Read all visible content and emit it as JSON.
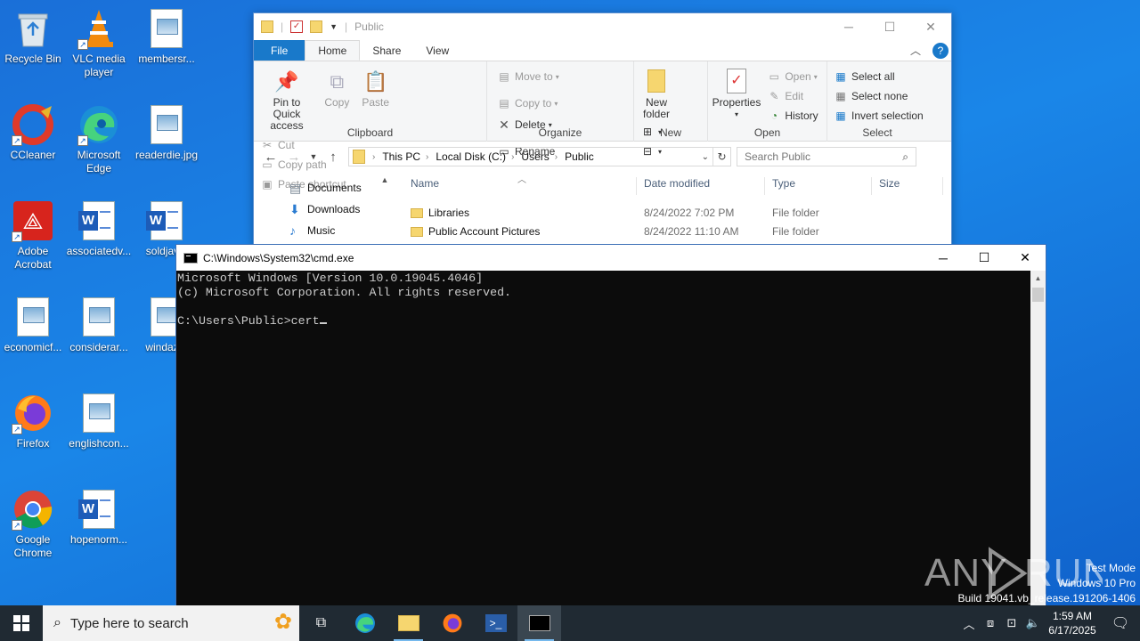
{
  "desktop": {
    "icons": [
      {
        "label": "Recycle Bin"
      },
      {
        "label": "VLC media player"
      },
      {
        "label": "membersr..."
      },
      {
        "label": "CCleaner"
      },
      {
        "label": "Microsoft Edge"
      },
      {
        "label": "readerdie.jpg"
      },
      {
        "label": "Adobe Acrobat"
      },
      {
        "label": "associatedv..."
      },
      {
        "label": "soldjav..."
      },
      {
        "label": "economicf..."
      },
      {
        "label": "considerar..."
      },
      {
        "label": "windaz..."
      },
      {
        "label": "Firefox"
      },
      {
        "label": "englishcon..."
      },
      {
        "label": "Google Chrome"
      },
      {
        "label": "hopenorm..."
      }
    ]
  },
  "explorer": {
    "title": "Public",
    "tabs": {
      "file": "File",
      "home": "Home",
      "share": "Share",
      "view": "View"
    },
    "clipboard": {
      "pin": "Pin to Quick access",
      "copy": "Copy",
      "paste": "Paste",
      "cut": "Cut",
      "copy_path": "Copy path",
      "paste_shortcut": "Paste shortcut",
      "label": "Clipboard"
    },
    "organize": {
      "move_to": "Move to",
      "copy_to": "Copy to",
      "delete": "Delete",
      "rename": "Rename",
      "label": "Organize"
    },
    "new": {
      "new_folder": "New folder",
      "label": "New"
    },
    "open": {
      "properties": "Properties",
      "open": "Open",
      "edit": "Edit",
      "history": "History",
      "label": "Open"
    },
    "select": {
      "select_all": "Select all",
      "select_none": "Select none",
      "invert": "Invert selection",
      "label": "Select"
    },
    "breadcrumb": [
      "This PC",
      "Local Disk (C:)",
      "Users",
      "Public"
    ],
    "search_placeholder": "Search Public",
    "nav_pane": [
      "Documents",
      "Downloads",
      "Music"
    ],
    "columns": {
      "name": "Name",
      "date": "Date modified",
      "type": "Type",
      "size": "Size"
    },
    "rows": [
      {
        "name": "Libraries",
        "date": "8/24/2022 7:02 PM",
        "type": "File folder"
      },
      {
        "name": "Public Account Pictures",
        "date": "8/24/2022 11:10 AM",
        "type": "File folder"
      }
    ]
  },
  "cmd": {
    "title": "C:\\Windows\\System32\\cmd.exe",
    "line1": "Microsoft Windows [Version 10.0.19045.4046]",
    "line2": "(c) Microsoft Corporation. All rights reserved.",
    "prompt": "C:\\Users\\Public>",
    "input": "cert"
  },
  "watermark": {
    "text": "ANY RUN"
  },
  "system_info": {
    "mode": "Test Mode",
    "os": "Windows 10 Pro",
    "build": "Build 19041.vb_release.191206-1406"
  },
  "taskbar": {
    "search_placeholder": "Type here to search",
    "time": "1:59 AM",
    "date": "6/17/2025"
  },
  "icons": {
    "start": "windows-logo-icon",
    "task_view": "task-view-icon",
    "edge": "edge-icon",
    "explorer": "file-explorer-icon",
    "firefox": "firefox-icon",
    "powershell": "powershell-icon",
    "cmd": "cmd-icon"
  },
  "colors": {
    "accent": "#1979ca",
    "desktop": "#1a7ae0",
    "taskbar": "#202a33",
    "console_bg": "#0c0c0c",
    "console_fg": "#cccccc"
  }
}
